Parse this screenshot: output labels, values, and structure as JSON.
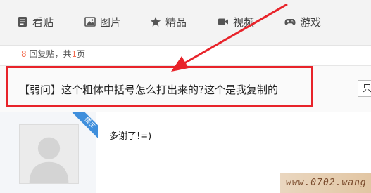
{
  "tabs": [
    {
      "label": "看贴",
      "icon": "document-icon"
    },
    {
      "label": "图片",
      "icon": "image-icon"
    },
    {
      "label": "精品",
      "icon": "star-icon"
    },
    {
      "label": "视频",
      "icon": "video-icon"
    },
    {
      "label": "游戏",
      "icon": "gamepad-icon"
    }
  ],
  "thread": {
    "reply_count": "8",
    "reply_label": " 回复贴，共",
    "page_count": "1",
    "page_label": "页",
    "title": "【弱问】这个粗体中括号怎么打出来的?这个是我复制的",
    "side_button_label": "只"
  },
  "post": {
    "badge": "楼主",
    "message": "多谢了!=)"
  },
  "watermark": "www.0702.wang",
  "colors": {
    "accent_red": "#e8232a",
    "count_orange": "#f26c4f",
    "badge_blue": "#3f8fdc"
  }
}
